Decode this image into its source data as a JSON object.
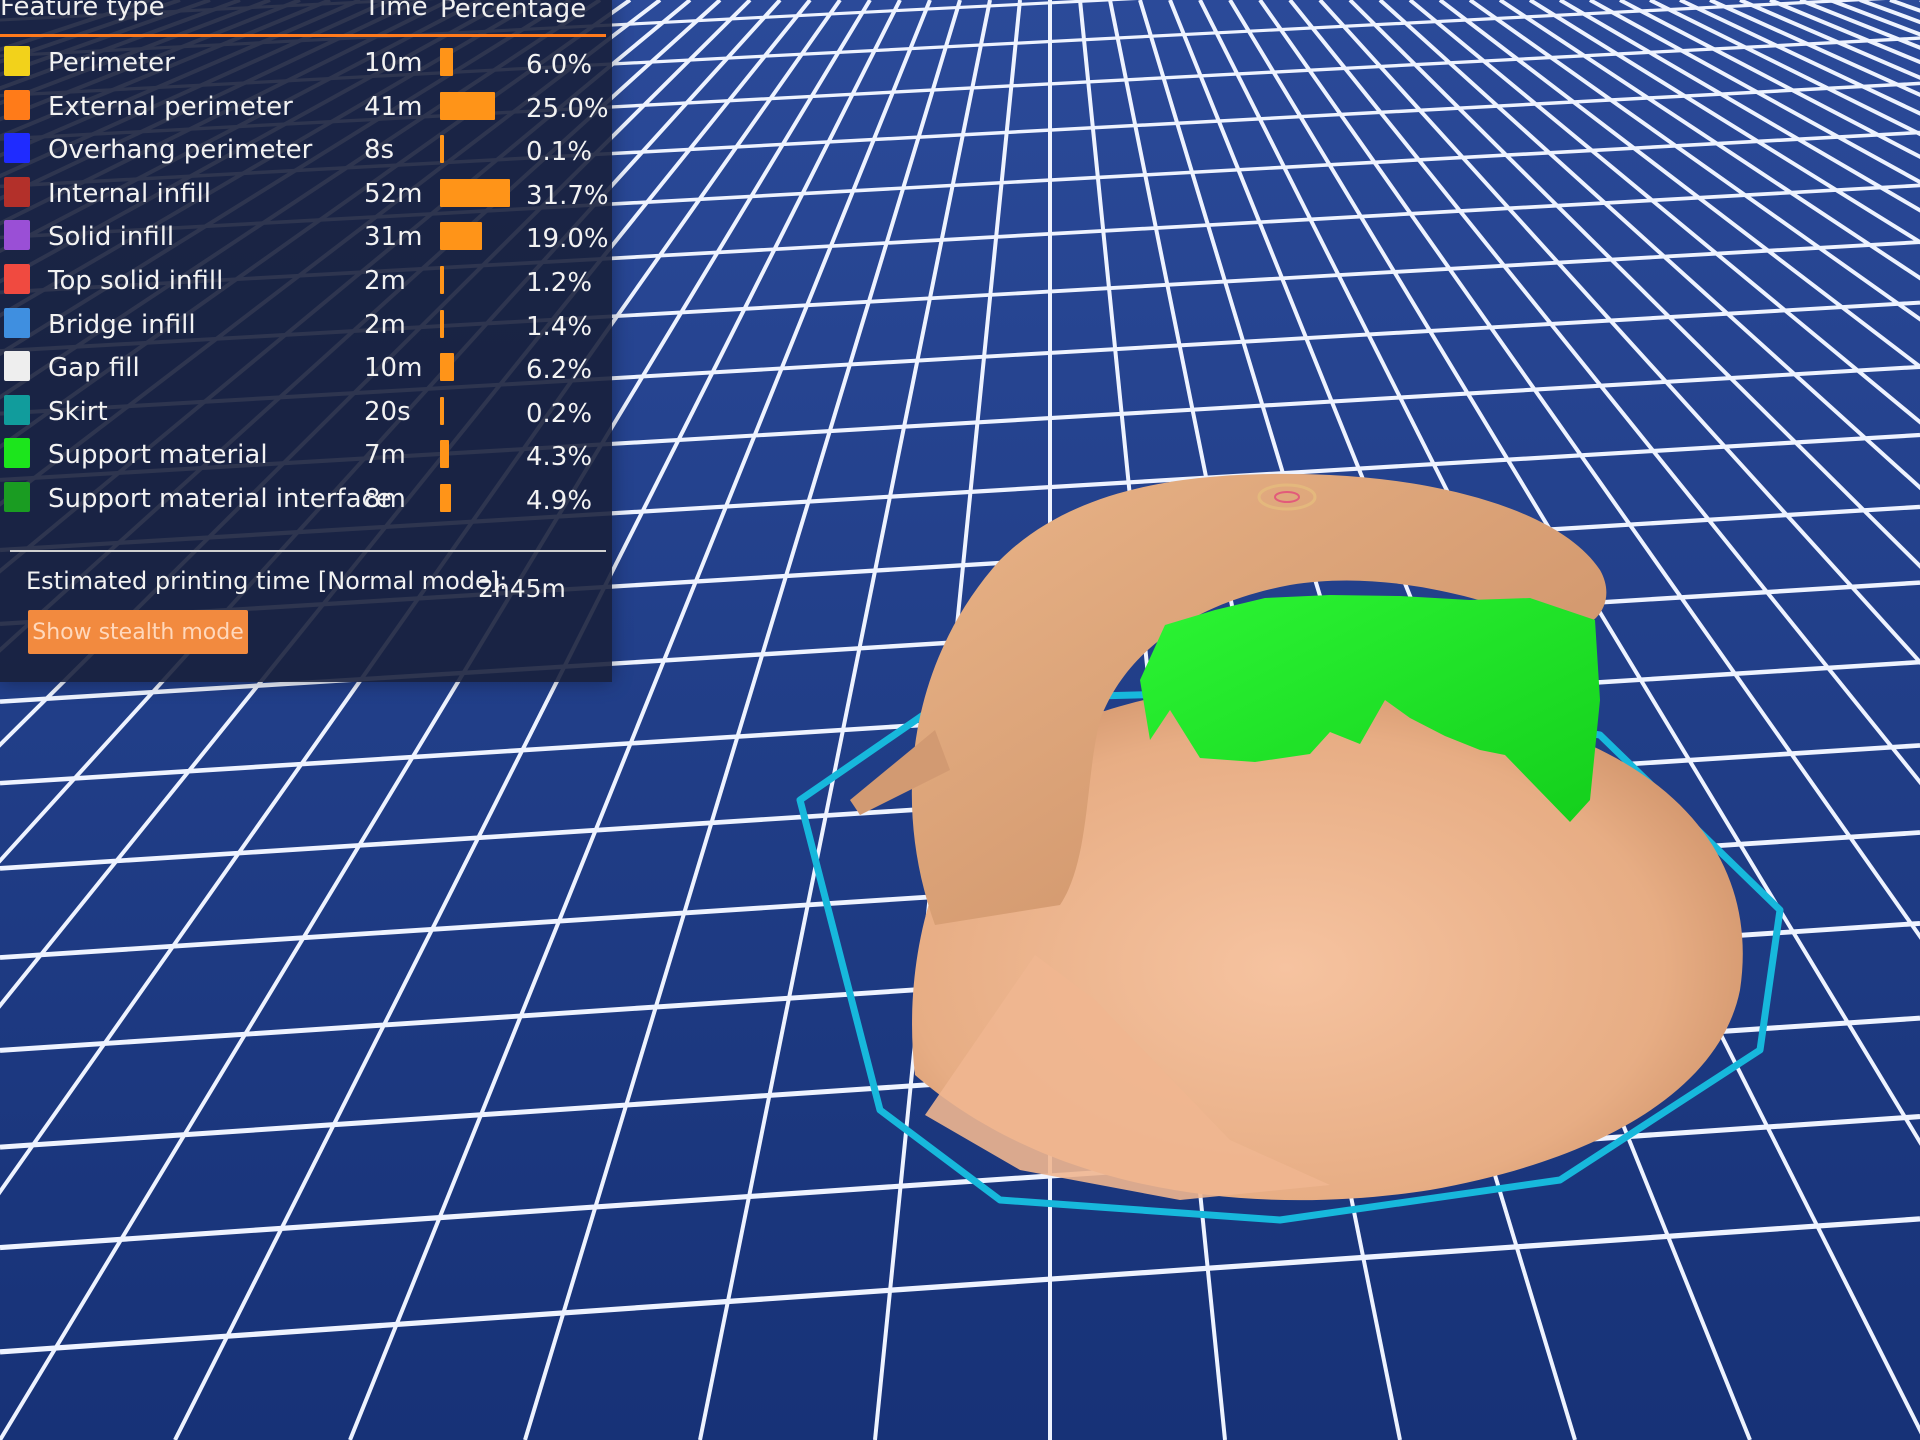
{
  "legend": {
    "headers": {
      "feature_type": "Feature type",
      "time": "Time",
      "percentage": "Percentage"
    },
    "rows": [
      {
        "label": "Perimeter",
        "time": "10m",
        "percentage": "6.0%",
        "fraction": 0.06,
        "color": "#f2d21b"
      },
      {
        "label": "External perimeter",
        "time": "41m",
        "percentage": "25.0%",
        "fraction": 0.25,
        "color": "#ff7b19"
      },
      {
        "label": "Overhang perimeter",
        "time": "8s",
        "percentage": "0.1%",
        "fraction": 0.001,
        "color": "#1f2bff"
      },
      {
        "label": "Internal infill",
        "time": "52m",
        "percentage": "31.7%",
        "fraction": 0.317,
        "color": "#b3302a"
      },
      {
        "label": "Solid infill",
        "time": "31m",
        "percentage": "19.0%",
        "fraction": 0.19,
        "color": "#9a4fd6"
      },
      {
        "label": "Top solid infill",
        "time": "2m",
        "percentage": "1.2%",
        "fraction": 0.012,
        "color": "#f04a40"
      },
      {
        "label": "Bridge infill",
        "time": "2m",
        "percentage": "1.4%",
        "fraction": 0.014,
        "color": "#3f8fe0"
      },
      {
        "label": "Gap fill",
        "time": "10m",
        "percentage": "6.2%",
        "fraction": 0.062,
        "color": "#eeeeee"
      },
      {
        "label": "Skirt",
        "time": "20s",
        "percentage": "0.2%",
        "fraction": 0.002,
        "color": "#119c9c"
      },
      {
        "label": "Support material",
        "time": "7m",
        "percentage": "4.3%",
        "fraction": 0.043,
        "color": "#1ce51c"
      },
      {
        "label": "Support material interface",
        "time": "8m",
        "percentage": "4.9%",
        "fraction": 0.049,
        "color": "#1a9c22"
      }
    ],
    "estimated_label": "Estimated printing time [Normal mode]:",
    "estimated_value": "2h45m",
    "stealth_button_label": "Show stealth mode"
  },
  "colors": {
    "accent": "#ff7a1c",
    "bar": "#ff9418",
    "model": "#e6ae84",
    "support": "#22ee2a",
    "skirt_outline": "#17b8dc",
    "bed_background": "#1e3a86",
    "grid_line": "#eef3ff"
  }
}
